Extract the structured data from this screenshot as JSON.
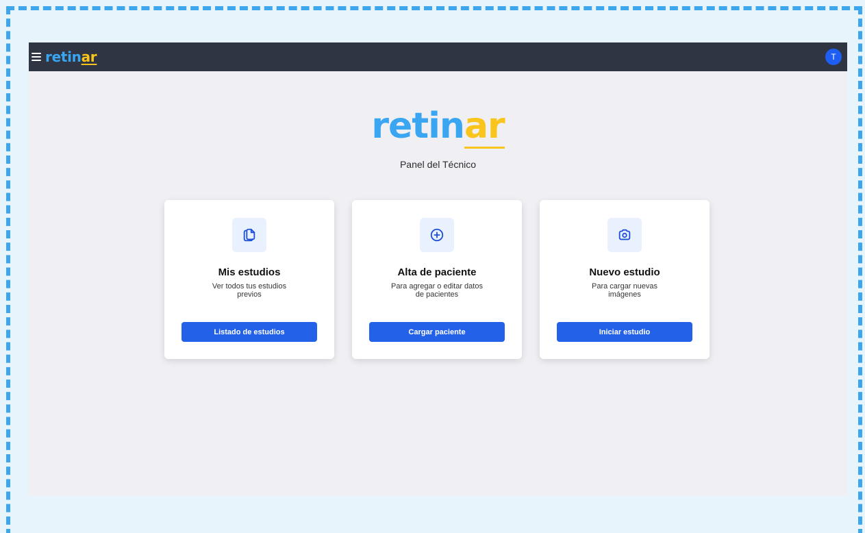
{
  "app": {
    "logo_part1": "retin",
    "logo_part2": "ar",
    "avatar_initial": "T"
  },
  "hero": {
    "logo_part1": "retin",
    "logo_part2": "ar",
    "subtitle": "Panel del Técnico"
  },
  "cards": [
    {
      "icon": "documents-icon",
      "title": "Mis estudios",
      "description": "Ver todos tus estudios previos",
      "button": "Listado de estudios"
    },
    {
      "icon": "plus-circle-icon",
      "title": "Alta de paciente",
      "description": "Para agregar o editar datos de pacientes",
      "button": "Cargar paciente"
    },
    {
      "icon": "camera-icon",
      "title": "Nuevo estudio",
      "description": "Para cargar nuevas imágenes",
      "button": "Iniciar estudio"
    }
  ],
  "colors": {
    "topbar": "#2f3542",
    "brand_blue": "#3aa5f0",
    "brand_yellow": "#f9c41c",
    "button": "#2461e9",
    "icon_bg": "#e8f1fd"
  }
}
